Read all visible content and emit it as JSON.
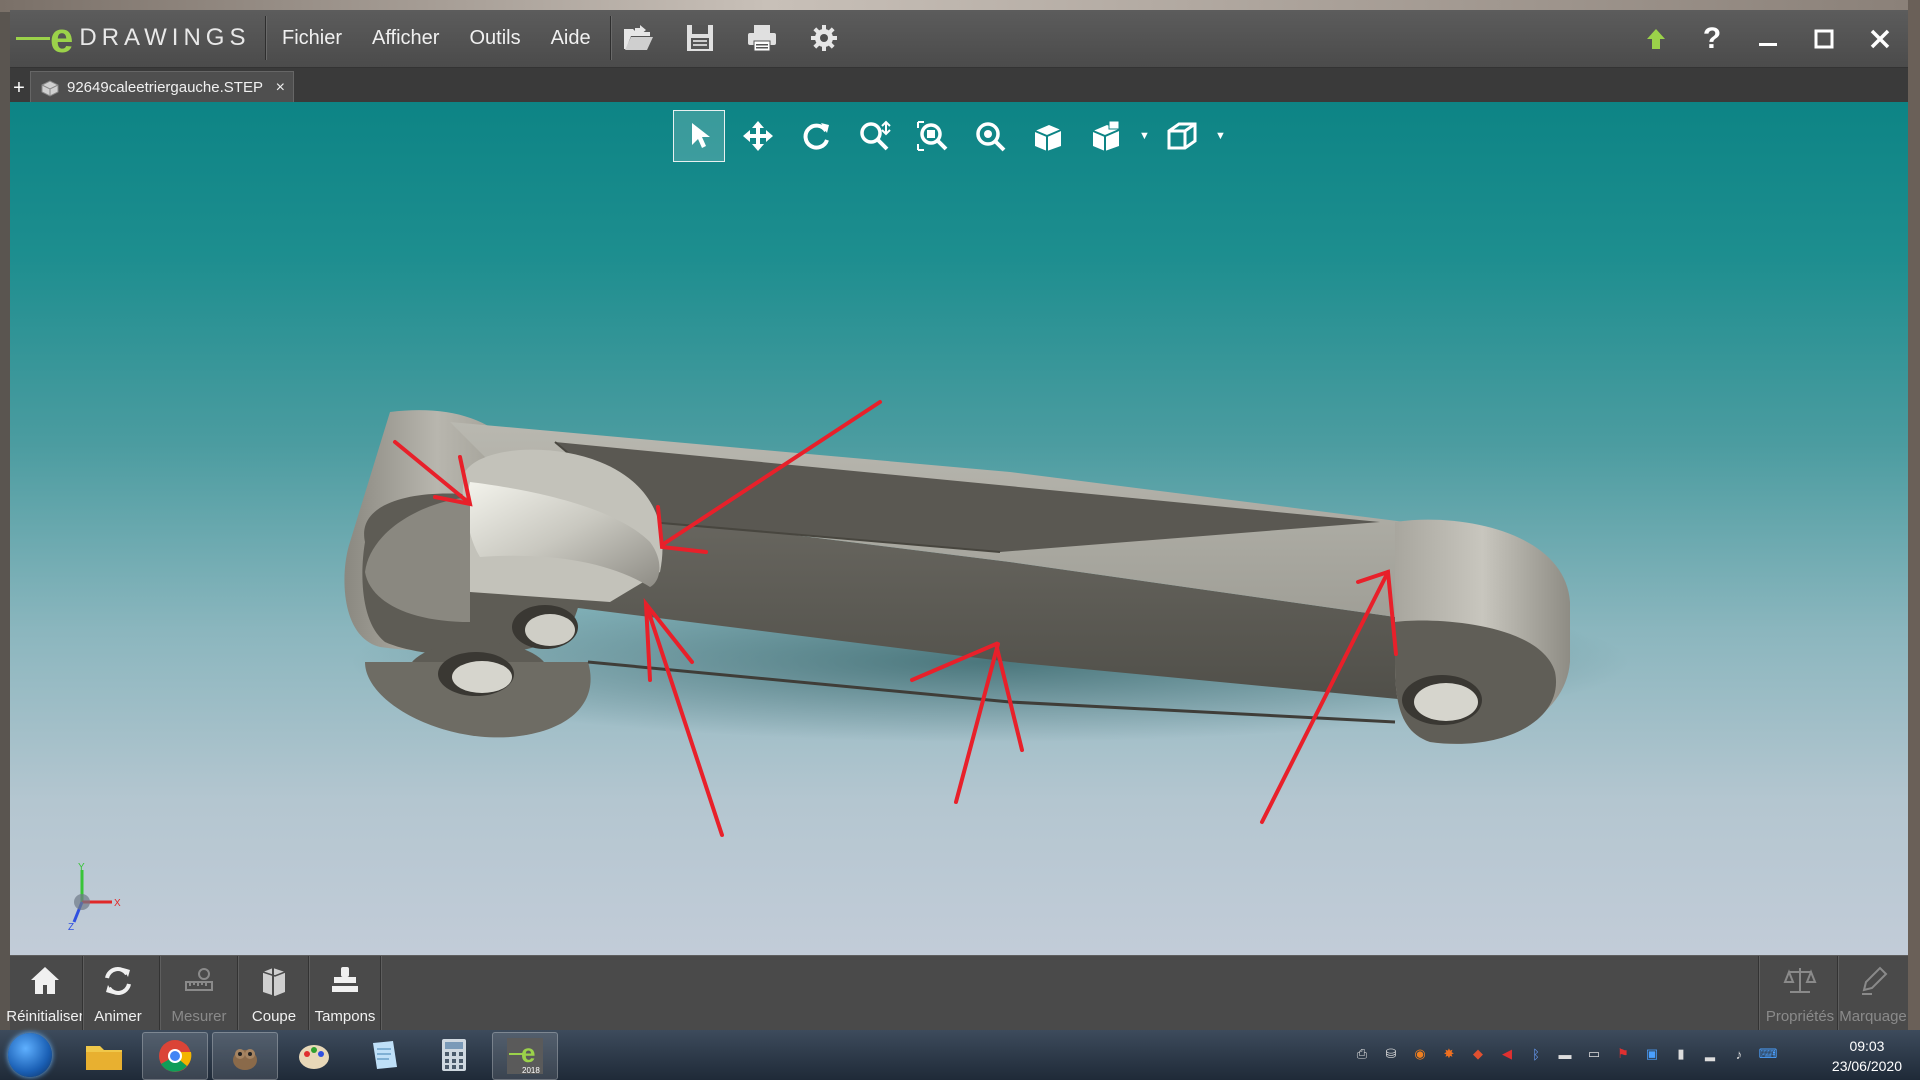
{
  "app": {
    "logo_word": "DRAWINGS",
    "logo_letter": "e",
    "menu": [
      "Fichier",
      "Afficher",
      "Outils",
      "Aide"
    ],
    "toolbar_icons": [
      "open-icon",
      "save-icon",
      "print-icon",
      "settings-icon"
    ],
    "right_controls": [
      "upload-icon",
      "help-icon",
      "minimize-icon",
      "maximize-icon",
      "close-icon"
    ],
    "help_glyph": "?"
  },
  "tab": {
    "filename": "92649caleetriergauche.STEP",
    "close_glyph": "×",
    "new_tab_glyph": "+"
  },
  "view_toolbar": {
    "tools": [
      "select-icon",
      "pan-icon",
      "rotate-icon",
      "zoom-area-icon",
      "zoom-fit-icon",
      "zoom-icon",
      "shaded-view-icon",
      "display-style-icon",
      "standard-views-icon"
    ],
    "active_tool": "select-icon"
  },
  "triad": {
    "x": "X",
    "y": "Y",
    "z": "Z"
  },
  "bottom_toolbar": {
    "left": [
      {
        "label": "Réinitialiser",
        "icon": "home-icon",
        "enabled": true
      },
      {
        "label": "Animer",
        "icon": "animate-icon",
        "enabled": true
      },
      {
        "label": "Mesurer",
        "icon": "measure-icon",
        "enabled": false
      },
      {
        "label": "Coupe",
        "icon": "section-icon",
        "enabled": true
      },
      {
        "label": "Tampons",
        "icon": "stamp-icon",
        "enabled": true
      }
    ],
    "right": [
      {
        "label": "Propriétés",
        "icon": "scale-icon",
        "enabled": false
      },
      {
        "label": "Marquage",
        "icon": "pen-icon",
        "enabled": false
      }
    ]
  },
  "taskbar": {
    "apps": [
      "folder-icon",
      "chrome-icon",
      "gimp-icon",
      "paint-icon",
      "notepad-icon",
      "calculator-icon",
      "edrawings-icon"
    ],
    "edrawings_badge": "2018",
    "time": "09:03",
    "date": "23/06/2020"
  },
  "colors": {
    "accent": "#9bd24a",
    "arrow": "#e8202a",
    "viewport_top": "#0d8485"
  }
}
